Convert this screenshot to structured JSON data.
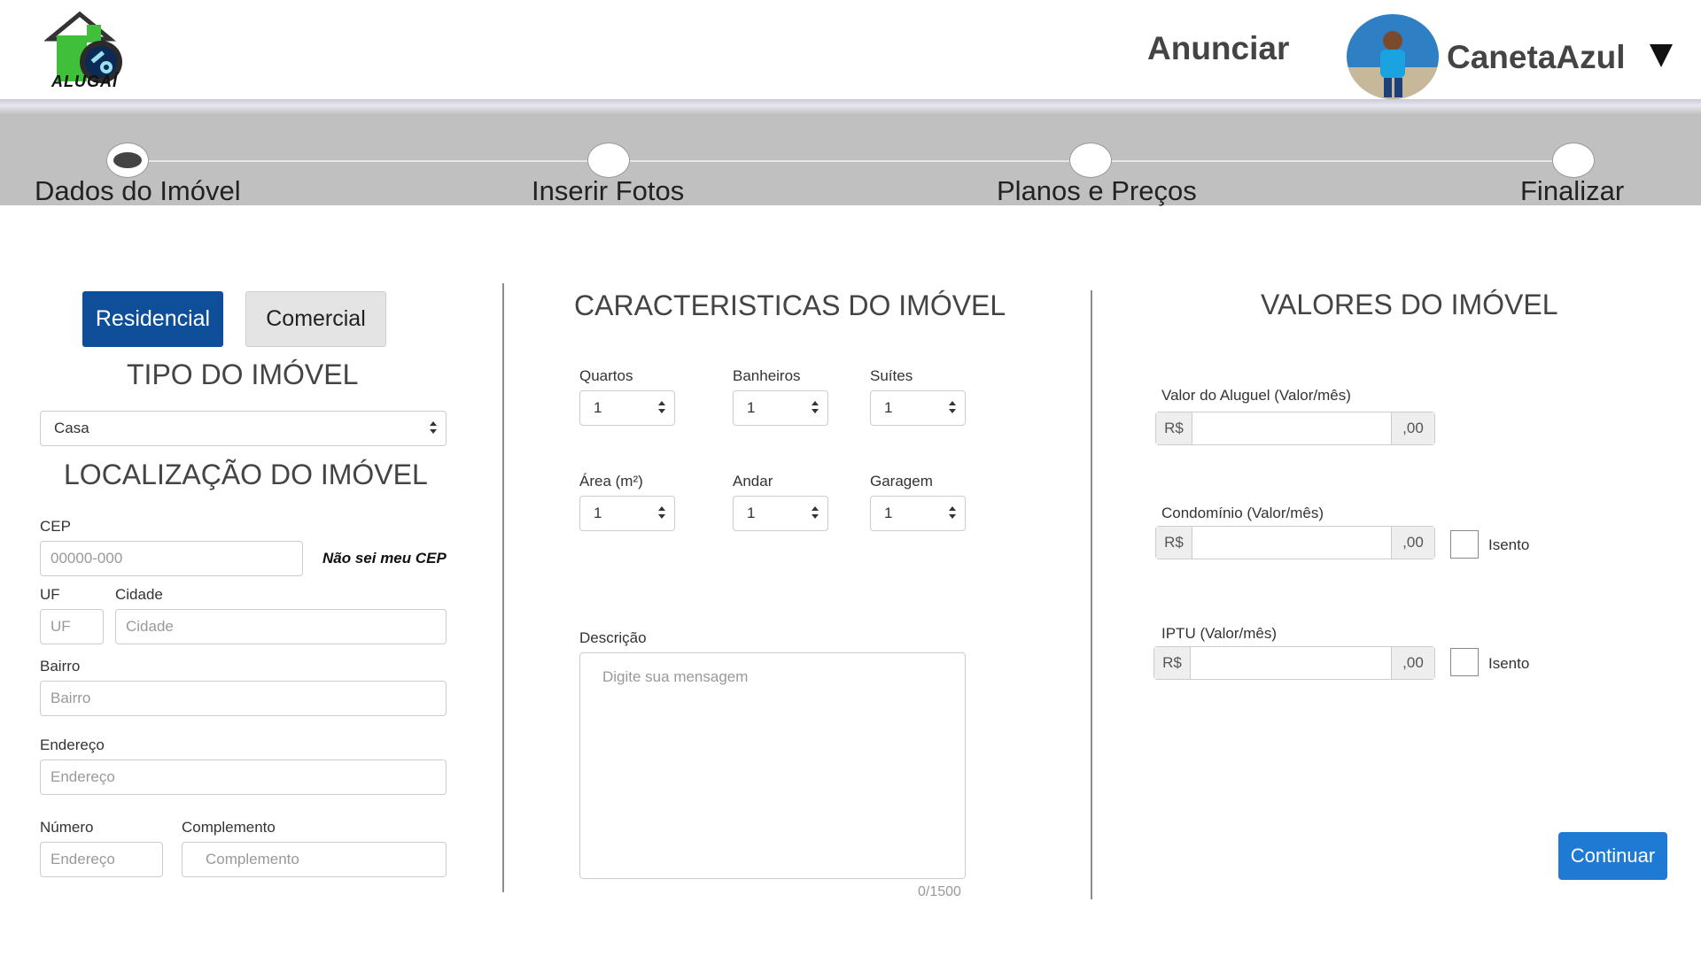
{
  "header": {
    "logo_text": "ALUGAÍ",
    "anunciar_label": "Anunciar",
    "username": "CanetaAzul"
  },
  "stepper": {
    "steps": [
      {
        "label": "Dados do Imóvel",
        "active": true
      },
      {
        "label": "Inserir Fotos",
        "active": false
      },
      {
        "label": "Planos e Preços",
        "active": false
      },
      {
        "label": "Finalizar",
        "active": false
      }
    ]
  },
  "left": {
    "residencial_label": "Residencial",
    "comercial_label": "Comercial",
    "tipo_title": "TIPO DO IMÓVEL",
    "tipo_value": "Casa",
    "localizacao_title": "LOCALIZAÇÃO DO IMÓVEL",
    "cep_label": "CEP",
    "cep_placeholder": "00000-000",
    "cep_link": "Não sei meu CEP",
    "uf_label": "UF",
    "uf_placeholder": "UF",
    "cidade_label": "Cidade",
    "cidade_placeholder": "Cidade",
    "bairro_label": "Bairro",
    "bairro_placeholder": "Bairro",
    "endereco_label": "Endereço",
    "endereco_placeholder": "Endereço",
    "numero_label": "Número",
    "numero_placeholder": "Endereço",
    "complemento_label": "Complemento",
    "complemento_placeholder": "Complemento"
  },
  "middle": {
    "title": "CARACTERISTICAS DO IMÓVEL",
    "quartos_label": "Quartos",
    "quartos_value": "1",
    "banheiros_label": "Banheiros",
    "banheiros_value": "1",
    "suites_label": "Suítes",
    "suites_value": "1",
    "area_label": "Área (m²)",
    "area_value": "1",
    "andar_label": "Andar",
    "andar_value": "1",
    "garagem_label": "Garagem",
    "garagem_value": "1",
    "descricao_label": "Descrição",
    "descricao_placeholder": "Digite sua mensagem",
    "counter": "0/1500"
  },
  "right": {
    "title": "VALORES DO IMÓVEL",
    "currency_prefix": "R$",
    "cents_suffix": ",00",
    "aluguel_label": "Valor do Aluguel (Valor/mês)",
    "condominio_label": "Condomínio (Valor/mês)",
    "iptu_label": "IPTU (Valor/mês)",
    "isento_label": "Isento",
    "continuar_label": "Continuar"
  },
  "colors": {
    "primary": "#0f4f9a",
    "continue": "#1f7ad3",
    "stepper_bg": "#c0c0c0",
    "logo_green": "#3fbf3a"
  }
}
